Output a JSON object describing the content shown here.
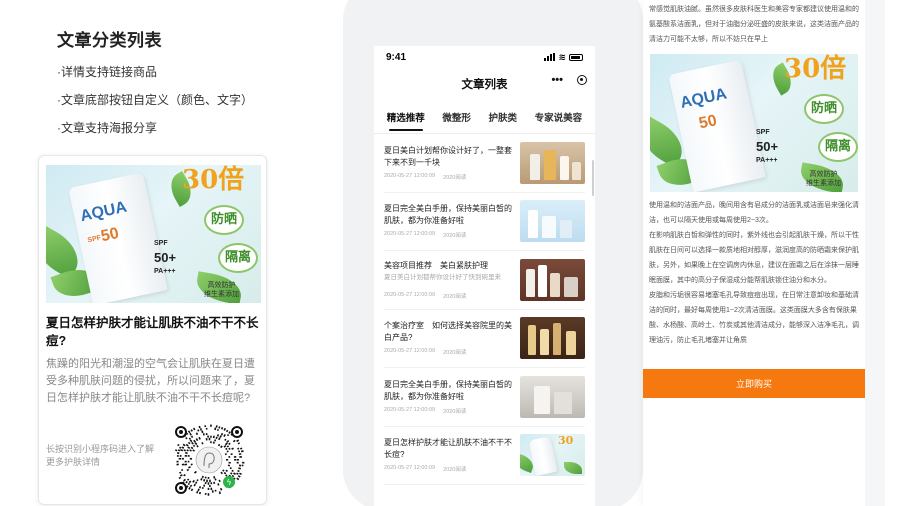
{
  "features": {
    "title": "文章分类列表",
    "items": [
      "·详情支持链接商品",
      "·文章底部按钮自定义（颜色、文字）",
      "·文章支持海报分享"
    ]
  },
  "poster": {
    "image_texts": {
      "brand": "AQUA",
      "spf": "SPF",
      "spf_value": "50+",
      "pa": "PA+++",
      "big": "30倍",
      "bubble1": "防晒",
      "bubble2": "隔离",
      "caption1": "高效防护",
      "caption2": "维生素添加"
    },
    "title": "夏日怎样护肤才能让肌肤不油不干不长痘?",
    "description": "焦躁的阳光和潮湿的空气会让肌肤在夏日遭受多种肌肤问题的侵扰，所以问题来了，夏日怎样护肤才能让肌肤不油不干不长痘呢?",
    "qr_tip": "长按识别小程序码进入了解更多护肤详情"
  },
  "phone": {
    "status_time": "9:41",
    "nav_title": "文章列表",
    "more_glyph": "•••",
    "tabs": [
      {
        "label": "精选推荐",
        "active": true
      },
      {
        "label": "微整形",
        "active": false
      },
      {
        "label": "护肤类",
        "active": false
      },
      {
        "label": "专家说美容",
        "active": false
      }
    ],
    "articles": [
      {
        "title": "夏日美白计划帮你设计好了，一整套下来不到一千块",
        "subtitle": "",
        "date": "2020-05-27 12:00:09",
        "reads": "2020阅读"
      },
      {
        "title": "夏日完全美白手册，保持美丽白皙的肌肤，都为你准备好啦",
        "subtitle": "",
        "date": "2020-05-27 12:00:09",
        "reads": "2020阅读"
      },
      {
        "title": "美容项目推荐　美白紧肤护理",
        "subtitle": "夏日美白计划都帮你设计好了快到碗里来",
        "date": "2020-05-27 12:00:09",
        "reads": "2020阅读"
      },
      {
        "title": "个案治疗室　如何选择美容院里的美白产品?",
        "subtitle": "",
        "date": "2020-05-27 12:00:09",
        "reads": "2020阅读"
      },
      {
        "title": "夏日完全美白手册，保持美丽白皙的肌肤，都为你准备好啦",
        "subtitle": "",
        "date": "2020-05-27 12:00:09",
        "reads": "2020阅读"
      },
      {
        "title": "夏日怎样护肤才能让肌肤不油不干不长痘?",
        "subtitle": "",
        "date": "2020-05-27 12:00:09",
        "reads": "2020阅读"
      }
    ]
  },
  "detail": {
    "top_text": "常感觉肌肤油腻。虽然很多皮肤科医生和美容专家都建议使用温和的氨基酸系洁面乳，但对于油脂分泌旺盛的皮肤来说，这类洁面产品的清洁力可能不太够，所以不妨只在早上",
    "body_paragraphs": [
      "使用温和的洁面产品，晚间用含有皂成分的洁面乳或洁面皂来强化清洁，也可以隔天使用或每周使用2~3次。",
      "在影响肌肤白皙和弹性的同时，紫外线也会引起肌肤干燥，所以干性肌肤在日间可以选择一款质地相对醇厚，滋润度高的防晒霜来保护肌肤，另外，如果晚上在空调房内休息，建议在面霜之后在涂抹一层睡眠面膜，其中的高分子保湿成分能帮肌肤锁住油分和水分。",
      "皮脂和污垢很容易堵塞毛孔导致痘痘出现，在日常注意卸妆和基础清洁的同时，最好每周使用1~2次清洁面膜。这类面膜大多含有保肤果酸、水杨酸、高岭土、竹炭或其他清洁成分，能够深入洁净毛孔，调理油污，防止毛孔堵塞并让角质"
    ],
    "buy_button": "立即购买"
  },
  "colors": {
    "accent": "#f5790f"
  }
}
